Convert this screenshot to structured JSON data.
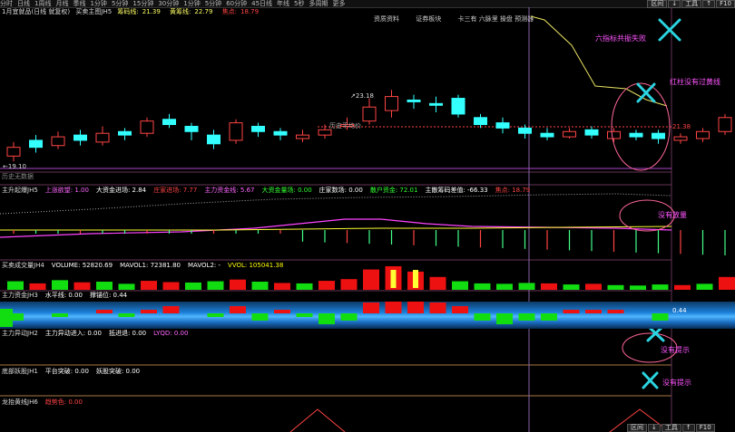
{
  "topbar": {
    "tabs": [
      "分时",
      "日线",
      "1周线",
      "月线",
      "季线",
      "1分钟",
      "5分钟",
      "15分钟",
      "30分钟",
      "1分钟",
      "5分钟",
      "60分钟",
      "45日线",
      "年线",
      "5秒",
      "多周期",
      "更多"
    ],
    "right_buttons": [
      "区间",
      "↓",
      "工具",
      "↑",
      "F10"
    ]
  },
  "main_panel": {
    "title": "1月宜就品(日线 就复权)",
    "indicator": "买卖主图JH5",
    "value_1_label": "筹码线:",
    "value_1": "21.39",
    "value_2_label": "黄筹线:",
    "value_2": "22.79",
    "value_3_label": "焦点:",
    "value_3": "18.79",
    "info_tabs": [
      "资质资料",
      "证券板块",
      "卡三有 六脉里 操盘 预测器"
    ],
    "high_label": "23.18",
    "low_label": "19.10",
    "right_price": "21.38",
    "dotted_note": "历史平均价",
    "bottom_note": "历史无数据"
  },
  "panel2": {
    "name": "主升起爆JH5",
    "items": [
      {
        "label": "上涨欲望:",
        "value": "1.00",
        "color": "#ff66ff"
      },
      {
        "label": "大资金进场:",
        "value": "2.84",
        "color": "#ffffff"
      },
      {
        "label": "庄家进场:",
        "value": "7.77",
        "color": "#ff4444"
      },
      {
        "label": "主力资金线:",
        "value": "5.67",
        "color": "#ff66ff"
      },
      {
        "label": "大资金量场:",
        "value": "0.00",
        "color": "#33ff33"
      },
      {
        "label": "庄家数场:",
        "value": "0.00",
        "color": "#ffffff"
      },
      {
        "label": "散户资金:",
        "value": "72.01",
        "color": "#33ff33"
      },
      {
        "label": "主散筹码差值:",
        "value": "-66.33",
        "color": "#ffffff"
      },
      {
        "label": "焦点:",
        "value": "18.79",
        "color": "#ff4444"
      }
    ]
  },
  "panel3": {
    "name": "买卖成交量JH4",
    "items": [
      {
        "label": "VOLUME:",
        "value": "52820.69",
        "color": "#ffffff"
      },
      {
        "label": "MAVOL1:",
        "value": "72381.80",
        "color": "#ffffff"
      },
      {
        "label": "MAVOL2:",
        "value": "-",
        "color": "#ffffff"
      },
      {
        "label": "VVOL:",
        "value": "105041.38",
        "color": "#ffff00"
      }
    ]
  },
  "panel4": {
    "name": "主力资金JH3",
    "items": [
      {
        "label": "水平线:",
        "value": "0.00",
        "color": "#ffffff"
      },
      {
        "label": "撑锚位:",
        "value": "0.44",
        "color": "#ffffff"
      }
    ],
    "right_value": "0.44"
  },
  "panel5": {
    "name": "主力异动JH2",
    "items": [
      {
        "label": "主力异动进入:",
        "value": "0.00",
        "color": "#ffffff"
      },
      {
        "label": "抵进退:",
        "value": "0.00",
        "color": "#ffffff"
      },
      {
        "label": "LYQD:",
        "value": "0.00",
        "color": "#ff66ff"
      }
    ]
  },
  "panel6": {
    "name": "底部妖股JH1",
    "items": [
      {
        "label": "平台突破:",
        "value": "0.00",
        "color": "#ffffff"
      },
      {
        "label": "妖股突破:",
        "value": "0.00",
        "color": "#ffffff"
      }
    ]
  },
  "panel7": {
    "name": "龙抬黄线JH6",
    "items": [
      {
        "label": "趋势色:",
        "value": "0.00",
        "color": "#ff4444"
      }
    ]
  },
  "annotations": {
    "ann1": "六指标共振失败",
    "ann2": "红柱没有过黄线",
    "ann3": "没有放量",
    "ann4": "没有提示",
    "ann5": "没有提示"
  },
  "colors": {
    "up": "#ff4444",
    "down": "#33ffff",
    "green": "#00e000",
    "annotation": "#ff55ff",
    "cross": "#2ad4e0",
    "yellow": "#ffff33"
  },
  "candles": [
    {
      "o": 19.4,
      "c": 19.9,
      "h": 20.2,
      "l": 19.1
    },
    {
      "o": 20.3,
      "c": 19.9,
      "h": 20.6,
      "l": 19.6
    },
    {
      "o": 20.0,
      "c": 20.5,
      "h": 20.8,
      "l": 19.8
    },
    {
      "o": 20.6,
      "c": 20.3,
      "h": 20.9,
      "l": 20.0
    },
    {
      "o": 20.2,
      "c": 20.7,
      "h": 21.1,
      "l": 20.0
    },
    {
      "o": 20.8,
      "c": 20.6,
      "h": 21.0,
      "l": 20.3
    },
    {
      "o": 20.7,
      "c": 21.4,
      "h": 21.6,
      "l": 20.5
    },
    {
      "o": 21.5,
      "c": 21.2,
      "h": 21.8,
      "l": 21.0
    },
    {
      "o": 21.1,
      "c": 20.8,
      "h": 21.3,
      "l": 20.3
    },
    {
      "o": 20.6,
      "c": 20.1,
      "h": 20.9,
      "l": 19.8
    },
    {
      "o": 20.3,
      "c": 21.3,
      "h": 21.5,
      "l": 20.1
    },
    {
      "o": 21.1,
      "c": 20.8,
      "h": 21.3,
      "l": 20.5
    },
    {
      "o": 20.8,
      "c": 20.6,
      "h": 21.0,
      "l": 20.3
    },
    {
      "o": 20.4,
      "c": 20.6,
      "h": 20.9,
      "l": 20.2
    },
    {
      "o": 20.6,
      "c": 20.9,
      "h": 21.2,
      "l": 20.4
    },
    {
      "o": 21.1,
      "c": 21.2,
      "h": 21.6,
      "l": 20.9
    },
    {
      "o": 21.4,
      "c": 22.2,
      "h": 22.7,
      "l": 21.2
    },
    {
      "o": 22.0,
      "c": 22.8,
      "h": 23.18,
      "l": 21.6
    },
    {
      "o": 22.6,
      "c": 22.5,
      "h": 22.9,
      "l": 22.1
    },
    {
      "o": 22.4,
      "c": 22.3,
      "h": 22.8,
      "l": 21.9
    },
    {
      "o": 22.7,
      "c": 21.8,
      "h": 22.9,
      "l": 21.6
    },
    {
      "o": 21.6,
      "c": 21.2,
      "h": 21.8,
      "l": 21.0
    },
    {
      "o": 21.3,
      "c": 21.0,
      "h": 21.6,
      "l": 20.7
    },
    {
      "o": 21.0,
      "c": 20.7,
      "h": 21.2,
      "l": 20.4
    },
    {
      "o": 20.7,
      "c": 20.5,
      "h": 21.0,
      "l": 20.3
    },
    {
      "o": 20.5,
      "c": 20.8,
      "h": 21.0,
      "l": 20.4
    },
    {
      "o": 20.9,
      "c": 20.6,
      "h": 21.1,
      "l": 20.4
    },
    {
      "o": 20.4,
      "c": 20.8,
      "h": 21.0,
      "l": 20.2
    },
    {
      "o": 20.7,
      "c": 20.5,
      "h": 20.9,
      "l": 20.3
    },
    {
      "o": 20.7,
      "c": 20.4,
      "h": 20.9,
      "l": 20.1
    },
    {
      "o": 20.3,
      "c": 20.5,
      "h": 20.7,
      "l": 20.1
    },
    {
      "o": 20.4,
      "c": 20.8,
      "h": 21.0,
      "l": 20.2
    },
    {
      "o": 20.8,
      "c": 21.6,
      "h": 21.8,
      "l": 20.6
    },
    {
      "o": 21.6,
      "c": 21.4,
      "h": 21.9,
      "l": 21.1
    }
  ],
  "volumes": [
    {
      "v": 40,
      "up": false
    },
    {
      "v": 30,
      "up": true
    },
    {
      "v": 45,
      "up": false
    },
    {
      "v": 35,
      "up": true
    },
    {
      "v": 38,
      "up": false
    },
    {
      "v": 28,
      "up": false
    },
    {
      "v": 42,
      "up": true
    },
    {
      "v": 36,
      "up": true
    },
    {
      "v": 34,
      "up": false
    },
    {
      "v": 40,
      "up": false
    },
    {
      "v": 48,
      "up": true
    },
    {
      "v": 38,
      "up": false
    },
    {
      "v": 32,
      "up": true
    },
    {
      "v": 30,
      "up": false
    },
    {
      "v": 42,
      "up": true
    },
    {
      "v": 50,
      "up": true
    },
    {
      "v": 95,
      "up": true
    },
    {
      "v": 110,
      "up": true
    },
    {
      "v": 85,
      "up": true
    },
    {
      "v": 60,
      "up": true
    },
    {
      "v": 40,
      "up": false
    },
    {
      "v": 30,
      "up": false
    },
    {
      "v": 28,
      "up": false
    },
    {
      "v": 32,
      "up": false
    },
    {
      "v": 30,
      "up": true
    },
    {
      "v": 25,
      "up": false
    },
    {
      "v": 28,
      "up": true
    },
    {
      "v": 22,
      "up": false
    },
    {
      "v": 20,
      "up": false
    },
    {
      "v": 25,
      "up": false
    },
    {
      "v": 22,
      "up": true
    },
    {
      "v": 28,
      "up": false
    },
    {
      "v": 60,
      "up": true
    },
    {
      "v": 20,
      "up": false
    }
  ],
  "zjbars": [
    {
      "v": 2,
      "up": false
    },
    {
      "v": 0,
      "up": true
    },
    {
      "v": 1,
      "up": false
    },
    {
      "v": 0,
      "up": true
    },
    {
      "v": 1,
      "up": true
    },
    {
      "v": 1,
      "up": false
    },
    {
      "v": 1,
      "up": true
    },
    {
      "v": 2,
      "up": true
    },
    {
      "v": 0,
      "up": true
    },
    {
      "v": 1,
      "up": false
    },
    {
      "v": 2,
      "up": true
    },
    {
      "v": 2,
      "up": false
    },
    {
      "v": 1,
      "up": true
    },
    {
      "v": 1,
      "up": false
    },
    {
      "v": 3,
      "up": false
    },
    {
      "v": 2,
      "up": false
    },
    {
      "v": 3,
      "up": true
    },
    {
      "v": 4,
      "up": true
    },
    {
      "v": 4,
      "up": true
    },
    {
      "v": 3,
      "up": true
    },
    {
      "v": 2,
      "up": true
    },
    {
      "v": 2,
      "up": false
    },
    {
      "v": 3,
      "up": false
    },
    {
      "v": 2,
      "up": false
    },
    {
      "v": 2,
      "up": false
    },
    {
      "v": 1,
      "up": true
    },
    {
      "v": 1,
      "up": true
    },
    {
      "v": 1,
      "up": true
    },
    {
      "v": 0,
      "up": true
    },
    {
      "v": 2,
      "up": false
    },
    {
      "v": 1,
      "up": true
    },
    {
      "v": 1,
      "up": true
    },
    {
      "v": 2,
      "up": true
    },
    {
      "v": 0,
      "up": true
    }
  ]
}
